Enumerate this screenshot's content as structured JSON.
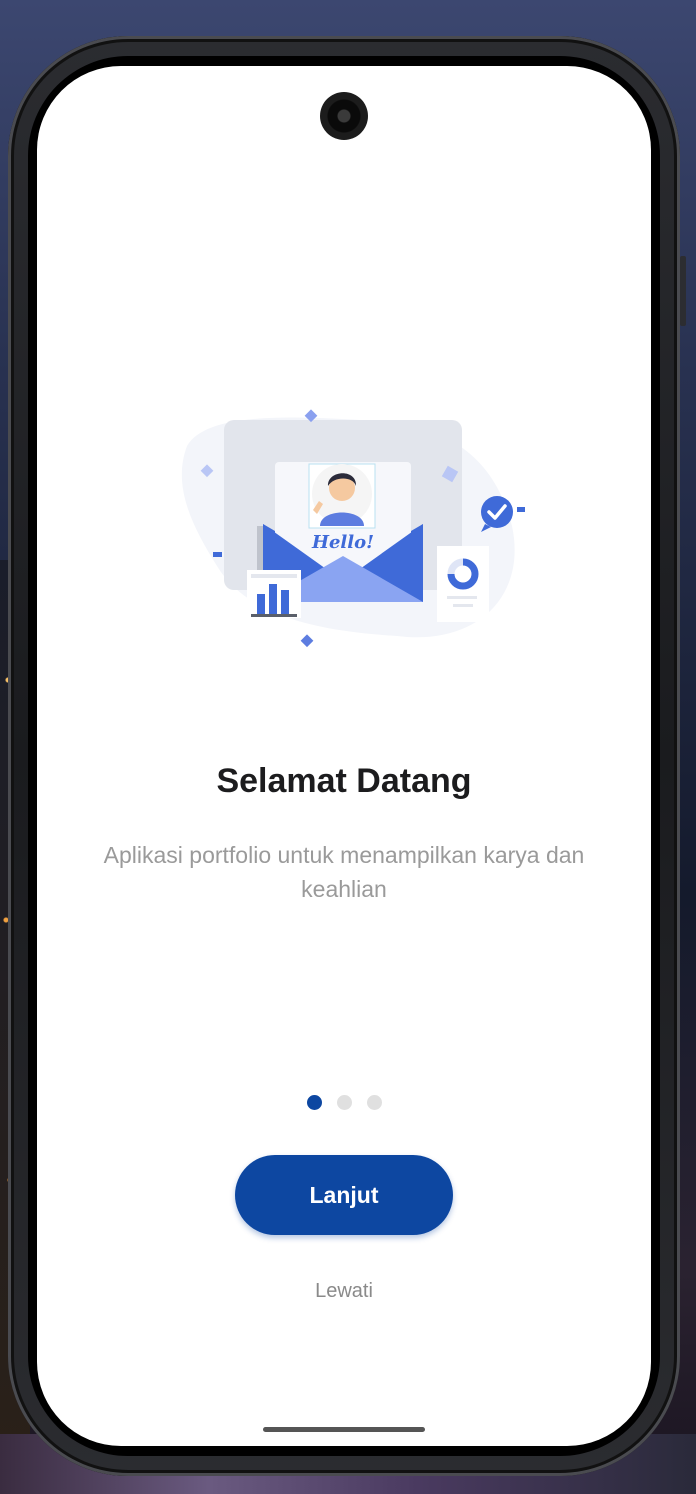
{
  "onboarding": {
    "title": "Selamat Datang",
    "subtitle": "Aplikasi portfolio untuk menampilkan karya dan keahlian",
    "illustration_text": "Hello!",
    "next_label": "Lanjut",
    "skip_label": "Lewati",
    "page_indicator": {
      "current": 1,
      "total": 3
    }
  },
  "colors": {
    "primary": "#0d47a1",
    "title": "#1c1c1e",
    "subtitle": "#9a9a9a",
    "dot_inactive": "#e0e0e0",
    "illustration_blue": "#3f6ad8"
  },
  "icons": [
    "camera-icon",
    "check-badge-icon",
    "bar-chart-icon",
    "donut-chart-icon",
    "envelope-icon"
  ]
}
